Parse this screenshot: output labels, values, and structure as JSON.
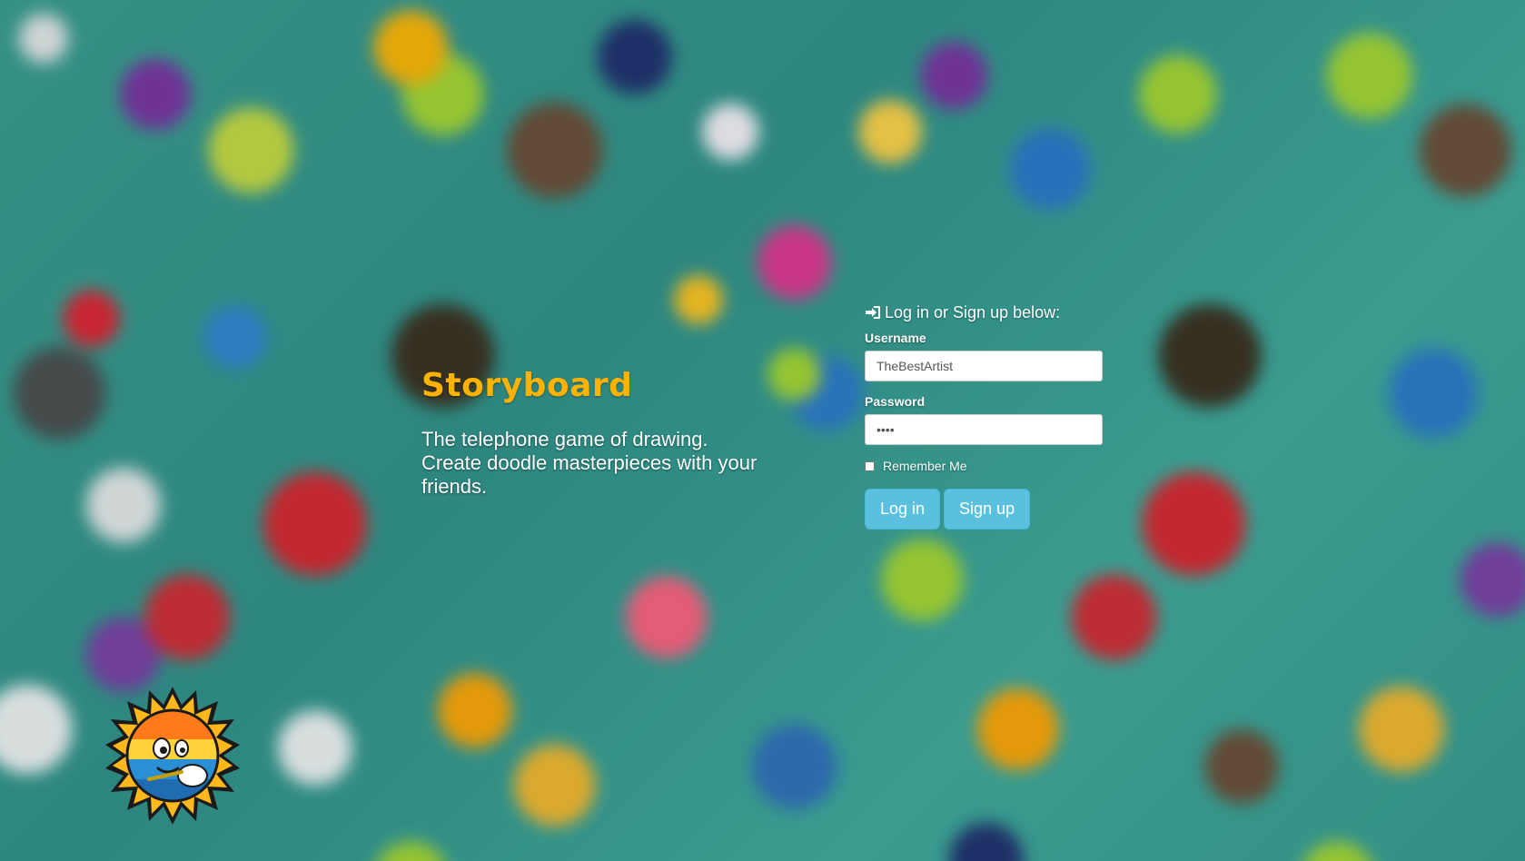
{
  "app": {
    "title": "Storyboard",
    "tagline": "The telephone game of drawing.\nCreate doodle masterpieces with your friends."
  },
  "login": {
    "heading": "Log in or Sign up below:",
    "heading_icon": "sign-in-icon",
    "username_label": "Username",
    "username_value": "TheBestArtist",
    "password_label": "Password",
    "password_value": "••••",
    "remember_label": "Remember Me",
    "remember_checked": false,
    "login_button": "Log in",
    "signup_button": "Sign up"
  },
  "mascot": {
    "icon": "sun-mascot-logo"
  },
  "colors": {
    "title": "#ffb300",
    "button": "#5bc0de",
    "background": "#3f9a8f"
  }
}
